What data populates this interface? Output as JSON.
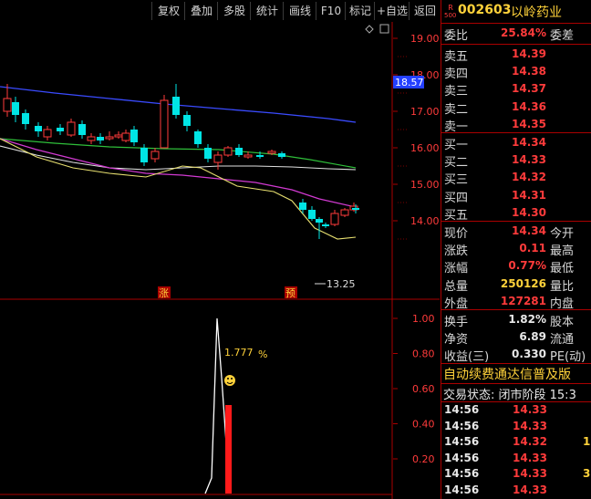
{
  "toolbar": {
    "buttons": [
      "复权",
      "叠加",
      "多股",
      "统计",
      "画线",
      "F10",
      "标记",
      "+自选",
      "返回"
    ]
  },
  "stock": {
    "badge_top": "R",
    "badge_bottom": "500",
    "code": "002603",
    "name": "以岭药业"
  },
  "order_ratio": {
    "label": "委比",
    "value": "25.84%",
    "label2": "委差"
  },
  "sell_levels": [
    {
      "label": "卖五",
      "price": "14.39"
    },
    {
      "label": "卖四",
      "price": "14.38"
    },
    {
      "label": "卖三",
      "price": "14.37"
    },
    {
      "label": "卖二",
      "price": "14.36"
    },
    {
      "label": "卖一",
      "price": "14.35"
    }
  ],
  "buy_levels": [
    {
      "label": "买一",
      "price": "14.34"
    },
    {
      "label": "买二",
      "price": "14.33"
    },
    {
      "label": "买三",
      "price": "14.32"
    },
    {
      "label": "买四",
      "price": "14.31"
    },
    {
      "label": "买五",
      "price": "14.30"
    }
  ],
  "quote": [
    {
      "label": "现价",
      "value": "14.34",
      "label2": "今开",
      "color": "#ff3b3b"
    },
    {
      "label": "涨跌",
      "value": "0.11",
      "label2": "最高",
      "color": "#ff3b3b"
    },
    {
      "label": "涨幅",
      "value": "0.77%",
      "label2": "最低",
      "color": "#ff3b3b"
    },
    {
      "label": "总量",
      "value": "250126",
      "label2": "量比",
      "color": "#ffd23a"
    },
    {
      "label": "外盘",
      "value": "127281",
      "label2": "内盘",
      "color": "#ff3b3b"
    }
  ],
  "fundamentals": [
    {
      "label": "换手",
      "value": "1.82%",
      "label2": "股本"
    },
    {
      "label": "净资",
      "value": "6.89",
      "label2": "流通"
    },
    {
      "label": "收益(三)",
      "value": "0.330",
      "label2": "PE(动)"
    }
  ],
  "marquee": "自动续费通达信普及版",
  "trade_status": "交易状态: 闭市阶段 15:3",
  "ticks": [
    {
      "time": "14:56",
      "price": "14.33",
      "vol": ""
    },
    {
      "time": "14:56",
      "price": "14.33",
      "vol": ""
    },
    {
      "time": "14:56",
      "price": "14.32",
      "vol": "1"
    },
    {
      "time": "14:56",
      "price": "14.33",
      "vol": ""
    },
    {
      "time": "14:56",
      "price": "14.33",
      "vol": "3"
    },
    {
      "time": "14:56",
      "price": "14.33",
      "vol": ""
    }
  ],
  "price_axis": [
    "19.00",
    "18.00",
    "17.00",
    "16.00",
    "15.00",
    "14.00"
  ],
  "ma_label": "18.57",
  "low_label": "13.25",
  "markers": [
    "涨",
    "预"
  ],
  "indicator_axis": [
    "1.00",
    "0.80",
    "0.60",
    "0.40",
    "0.20"
  ],
  "indicator_label": "1.777",
  "indicator_unit": "%",
  "colors": {
    "up": "#ff3b3b",
    "down": "#00e5e5",
    "accent": "#ffd23a",
    "border": "#aa0000"
  },
  "chart_data": {
    "type": "candlestick",
    "ylim": [
      13.0,
      19.5
    ],
    "candles": [
      {
        "o": 17.0,
        "c": 17.35,
        "h": 17.75,
        "l": 16.85
      },
      {
        "o": 17.25,
        "c": 16.9,
        "h": 17.4,
        "l": 16.7
      },
      {
        "o": 16.95,
        "c": 16.65,
        "h": 17.05,
        "l": 16.5
      },
      {
        "o": 16.6,
        "c": 16.45,
        "h": 16.7,
        "l": 16.3
      },
      {
        "o": 16.3,
        "c": 16.5,
        "h": 16.6,
        "l": 16.2
      },
      {
        "o": 16.55,
        "c": 16.45,
        "h": 16.65,
        "l": 16.35
      },
      {
        "o": 16.35,
        "c": 16.7,
        "h": 16.8,
        "l": 16.3
      },
      {
        "o": 16.65,
        "c": 16.35,
        "h": 16.75,
        "l": 16.25
      },
      {
        "o": 16.2,
        "c": 16.3,
        "h": 16.4,
        "l": 16.1
      },
      {
        "o": 16.3,
        "c": 16.2,
        "h": 16.4,
        "l": 16.1
      },
      {
        "o": 16.25,
        "c": 16.3,
        "h": 16.45,
        "l": 16.2
      },
      {
        "o": 16.3,
        "c": 16.35,
        "h": 16.45,
        "l": 16.25
      },
      {
        "o": 16.2,
        "c": 16.4,
        "h": 16.5,
        "l": 16.15
      },
      {
        "o": 16.5,
        "c": 16.15,
        "h": 16.6,
        "l": 16.05
      },
      {
        "o": 16.0,
        "c": 15.6,
        "h": 16.1,
        "l": 15.5
      },
      {
        "o": 15.7,
        "c": 15.9,
        "h": 16.0,
        "l": 15.6
      },
      {
        "o": 16.0,
        "c": 17.3,
        "h": 17.45,
        "l": 16.0
      },
      {
        "o": 17.4,
        "c": 16.9,
        "h": 17.75,
        "l": 16.8
      },
      {
        "o": 16.9,
        "c": 16.6,
        "h": 17.0,
        "l": 16.45
      },
      {
        "o": 16.45,
        "c": 16.1,
        "h": 16.5,
        "l": 16.0
      },
      {
        "o": 16.0,
        "c": 15.7,
        "h": 16.1,
        "l": 15.6
      },
      {
        "o": 15.6,
        "c": 15.8,
        "h": 15.9,
        "l": 15.4
      },
      {
        "o": 15.8,
        "c": 16.0,
        "h": 16.05,
        "l": 15.75
      },
      {
        "o": 16.0,
        "c": 15.8,
        "h": 16.1,
        "l": 15.75
      },
      {
        "o": 15.75,
        "c": 15.8,
        "h": 15.9,
        "l": 15.7
      },
      {
        "o": 15.8,
        "c": 15.75,
        "h": 15.9,
        "l": 15.7
      },
      {
        "o": 15.85,
        "c": 15.9,
        "h": 15.95,
        "l": 15.8
      },
      {
        "o": 15.85,
        "c": 15.75,
        "h": 15.9,
        "l": 15.7
      },
      {
        "o": 14.5,
        "c": 14.3,
        "h": 14.6,
        "l": 14.2
      },
      {
        "o": 14.3,
        "c": 14.05,
        "h": 14.4,
        "l": 14.0
      },
      {
        "o": 14.05,
        "c": 13.95,
        "h": 14.1,
        "l": 13.5
      },
      {
        "o": 13.9,
        "c": 13.85,
        "h": 13.95,
        "l": 13.8
      },
      {
        "o": 13.9,
        "c": 14.2,
        "h": 14.3,
        "l": 13.85
      },
      {
        "o": 14.15,
        "c": 14.3,
        "h": 14.35,
        "l": 14.1
      },
      {
        "o": 14.3,
        "c": 14.4,
        "h": 14.5,
        "l": 14.25
      },
      {
        "o": 14.35,
        "c": 14.3,
        "h": 14.45,
        "l": 14.2
      }
    ]
  }
}
